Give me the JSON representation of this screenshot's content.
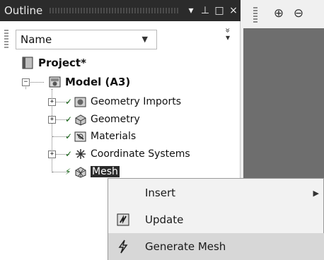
{
  "outline": {
    "title": "Outline",
    "header_buttons": {
      "dropdown": "▾",
      "pin": "⊥",
      "maximize": "□",
      "close": "×"
    },
    "filter": {
      "selected": "Name",
      "overflow": "»"
    },
    "tree": {
      "project": "Project*",
      "model": "Model (A3)",
      "children": [
        {
          "label": "Geometry Imports"
        },
        {
          "label": "Geometry"
        },
        {
          "label": "Materials"
        },
        {
          "label": "Coordinate Systems"
        },
        {
          "label": "Mesh"
        }
      ]
    }
  },
  "toolbar": {
    "zoom_in": "⊕",
    "zoom_out": "⊖"
  },
  "context_menu": {
    "items": [
      {
        "label": "Insert"
      },
      {
        "label": "Update"
      },
      {
        "label": "Generate Mesh"
      }
    ]
  },
  "colors": {
    "header_bg": "#2b2b2b",
    "graphics_bg": "#6e6e6e",
    "menu_highlight": "#d7d7d7"
  }
}
